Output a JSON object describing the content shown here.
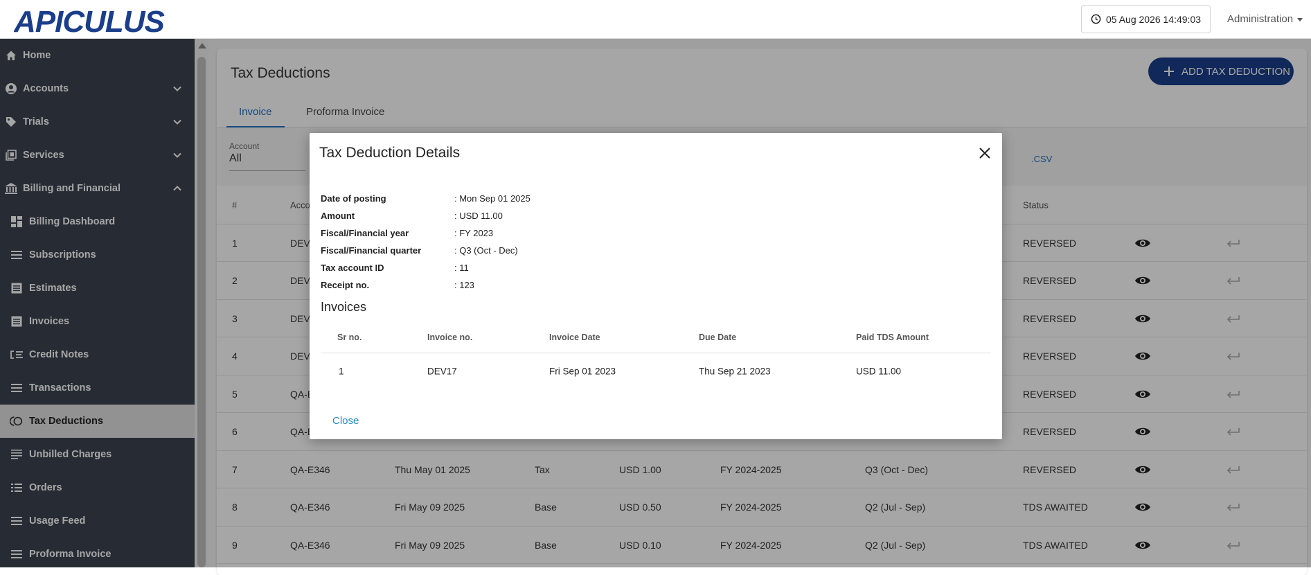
{
  "header": {
    "logo_text": "APICULUS",
    "datetime": "05 Aug 2026 14:49:03",
    "user_menu": "Administration"
  },
  "sidebar": {
    "items": [
      {
        "label": "Home",
        "icon": "home-icon"
      },
      {
        "label": "Accounts",
        "icon": "user-circle-icon",
        "expandable": "down"
      },
      {
        "label": "Trials",
        "icon": "tag-icon",
        "expandable": "down"
      },
      {
        "label": "Services",
        "icon": "services-icon",
        "expandable": "down"
      },
      {
        "label": "Billing and Financial",
        "icon": "bank-icon",
        "expandable": "up"
      },
      {
        "label": "Billing Dashboard",
        "icon": "dashboard-icon"
      },
      {
        "label": "Subscriptions",
        "icon": "list-icon"
      },
      {
        "label": "Estimates",
        "icon": "document-icon"
      },
      {
        "label": "Invoices",
        "icon": "document-icon"
      },
      {
        "label": "Credit Notes",
        "icon": "credit-notes-icon"
      },
      {
        "label": "Transactions",
        "icon": "list-icon"
      },
      {
        "label": "Tax Deductions",
        "icon": "tax-icon",
        "active": true
      },
      {
        "label": "Unbilled Charges",
        "icon": "lines-icon"
      },
      {
        "label": "Orders",
        "icon": "list-icon"
      },
      {
        "label": "Usage Feed",
        "icon": "list-icon"
      },
      {
        "label": "Proforma Invoice",
        "icon": "list-icon"
      }
    ]
  },
  "page": {
    "title": "Tax Deductions",
    "add_button": "ADD TAX DEDUCTION",
    "tabs": [
      "Invoice",
      "Proforma Invoice"
    ],
    "active_tab": "Invoice",
    "filter": {
      "label": "Account",
      "value": "All"
    },
    "csv_link": ".CSV"
  },
  "table": {
    "headers": {
      "num": "#",
      "account": "Accou",
      "status": "Status"
    },
    "rows": [
      {
        "num": "1",
        "account": "DEV-",
        "date": "",
        "type": "",
        "amount": "",
        "fy": "",
        "quarter": "",
        "status": "REVERSED"
      },
      {
        "num": "2",
        "account": "DEV-",
        "date": "",
        "type": "",
        "amount": "",
        "fy": "",
        "quarter": "",
        "status": "REVERSED"
      },
      {
        "num": "3",
        "account": "DEV-",
        "date": "",
        "type": "",
        "amount": "",
        "fy": "",
        "quarter": "",
        "status": "REVERSED"
      },
      {
        "num": "4",
        "account": "DEV-",
        "date": "",
        "type": "",
        "amount": "",
        "fy": "",
        "quarter": "",
        "status": "REVERSED"
      },
      {
        "num": "5",
        "account": "QA-E",
        "date": "",
        "type": "",
        "amount": "",
        "fy": "",
        "quarter": "",
        "status": "REVERSED"
      },
      {
        "num": "6",
        "account": "QA-E",
        "date": "",
        "type": "",
        "amount": "",
        "fy": "",
        "quarter": "",
        "status": "REVERSED"
      },
      {
        "num": "7",
        "account": "QA-E346",
        "date": "Thu May 01 2025",
        "type": "Tax",
        "amount": "USD 1.00",
        "fy": "FY 2024-2025",
        "quarter": "Q3 (Oct - Dec)",
        "status": "REVERSED"
      },
      {
        "num": "8",
        "account": "QA-E346",
        "date": "Fri May 09 2025",
        "type": "Base",
        "amount": "USD 0.50",
        "fy": "FY 2024-2025",
        "quarter": "Q2 (Jul - Sep)",
        "status": "TDS AWAITED"
      },
      {
        "num": "9",
        "account": "QA-E346",
        "date": "Fri May 09 2025",
        "type": "Base",
        "amount": "USD 0.10",
        "fy": "FY 2024-2025",
        "quarter": "Q2 (Jul - Sep)",
        "status": "TDS AWAITED"
      }
    ]
  },
  "modal": {
    "title": "Tax Deduction Details",
    "details": [
      {
        "key": "Date of posting",
        "value": ": Mon Sep 01 2025"
      },
      {
        "key": "Amount",
        "value": ": USD 11.00"
      },
      {
        "key": "Fiscal/Financial year",
        "value": ": FY 2023"
      },
      {
        "key": "Fiscal/Financial quarter",
        "value": ": Q3 (Oct - Dec)"
      },
      {
        "key": "Tax account ID",
        "value": ": 11"
      },
      {
        "key": "Receipt no.",
        "value": ": 123"
      }
    ],
    "invoices_title": "Invoices",
    "invoice_headers": [
      "Sr no.",
      "Invoice no.",
      "Invoice Date",
      "Due Date",
      "Paid TDS Amount"
    ],
    "invoice_rows": [
      {
        "sr": "1",
        "invoice_no": "DEV17",
        "invoice_date": "Fri Sep 01 2023",
        "due_date": "Thu Sep 21 2023",
        "paid_tds": "USD 11.00"
      }
    ],
    "close_label": "Close"
  },
  "colors": {
    "brand": "#1a3e8a",
    "sidebar_bg": "#3d4450",
    "link": "#1e6fc1"
  }
}
